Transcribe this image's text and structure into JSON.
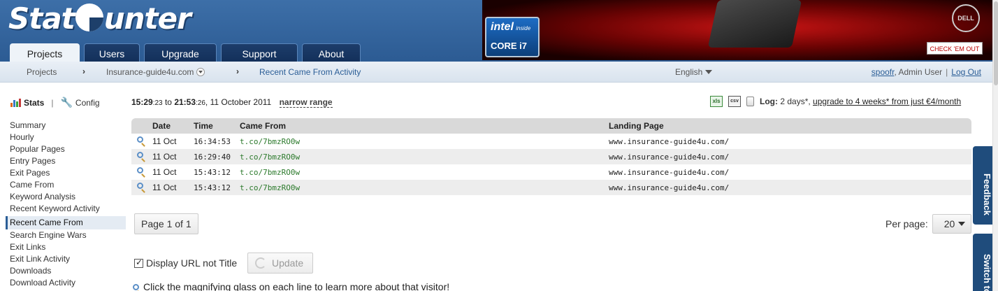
{
  "header": {
    "logo": {
      "part1": "Stat",
      "part2": "unter"
    },
    "tabs": [
      {
        "label": "Projects",
        "active": true
      },
      {
        "label": "Users",
        "active": false
      },
      {
        "label": "Upgrade",
        "active": false
      },
      {
        "label": "Support",
        "active": false
      },
      {
        "label": "About",
        "active": false
      }
    ],
    "ad": {
      "intel": "intel",
      "inside": "inside",
      "core": "CORE i7",
      "brand": "DELL",
      "cta": "CHECK 'EM OUT"
    }
  },
  "breadcrumb": {
    "items": [
      "Projects",
      "Insurance-guide4u.com",
      "Recent Came From Activity"
    ],
    "separator": "›"
  },
  "language": "English",
  "user": {
    "name": "spoofr",
    "role": ", Admin User",
    "logout": "Log Out"
  },
  "sidebar": {
    "stats": "Stats",
    "config": "Config",
    "items": [
      "Summary",
      "Hourly",
      "Popular Pages",
      "Entry Pages",
      "Exit Pages",
      "Came From",
      "Keyword Analysis",
      "Recent Keyword Activity",
      "Recent Came From",
      "Search Engine Wars",
      "Exit Links",
      "Exit Link Activity",
      "Downloads",
      "Download Activity"
    ],
    "active_item": "Recent Came From"
  },
  "range": {
    "start_time": "15:29",
    "start_sec": ":23",
    "to": "to",
    "end_time": "21:53",
    "end_sec": ":26",
    "date": "11 October 2011",
    "narrow_label": "narrow range"
  },
  "export": {
    "xls": "xls",
    "csv": "csv",
    "log_label": "Log:",
    "log_value": "2 days*,",
    "upgrade_link": "upgrade to 4 weeks* from just €4/month"
  },
  "table": {
    "columns": [
      "Date",
      "Time",
      "Came From",
      "Landing Page"
    ],
    "rows": [
      {
        "date": "11 Oct",
        "time": "16:34:53",
        "from": "t.co/7bmzRO0w",
        "landing": "www.insurance-guide4u.com/"
      },
      {
        "date": "11 Oct",
        "time": "16:29:40",
        "from": "t.co/7bmzRO0w",
        "landing": "www.insurance-guide4u.com/"
      },
      {
        "date": "11 Oct",
        "time": "15:43:12",
        "from": "t.co/7bmzRO0w",
        "landing": "www.insurance-guide4u.com/"
      },
      {
        "date": "11 Oct",
        "time": "15:43:12",
        "from": "t.co/7bmzRO0w",
        "landing": "www.insurance-guide4u.com/"
      }
    ]
  },
  "pager": {
    "label": "Page 1 of 1"
  },
  "per_page": {
    "label": "Per page:",
    "value": "20"
  },
  "options": {
    "display_url_label": "Display URL not Title",
    "display_url_checked": true,
    "update_label": "Update"
  },
  "hint": "Click the magnifying glass on each line to learn more about that visitor!",
  "side_tabs": {
    "feedback": "Feedback",
    "switch": "Switch to"
  }
}
